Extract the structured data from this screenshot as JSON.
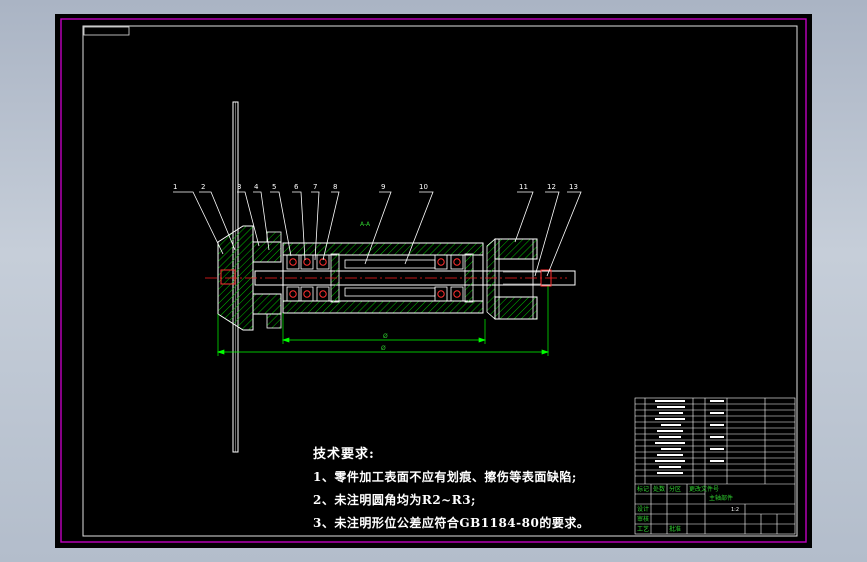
{
  "drawing": {
    "part_labels": [
      "1",
      "2",
      "3",
      "4",
      "5",
      "6",
      "7",
      "8",
      "9",
      "10",
      "11",
      "12",
      "13"
    ],
    "section_mark": "A-A",
    "dimension_text": "Ø"
  },
  "notes": {
    "title": "技术要求:",
    "lines": [
      "1、零件加工表面不应有划痕、擦伤等表面缺陷;",
      "2、未注明圆角均为R2~R3;",
      "3、未注明形位公差应符合GB1184-80的要求。"
    ]
  },
  "title_block": {
    "drawing_name": "主轴部件",
    "scale": "1:2",
    "green_cells": [
      "标记",
      "处数",
      "分区",
      "更改文件号",
      "签名",
      "年月日",
      "设计",
      "审核",
      "工艺",
      "批准"
    ]
  },
  "colors": {
    "frame": "#c000c0",
    "ink": "#ffffff",
    "dim": "#00ff00",
    "center": "#ff2020",
    "hatch": "#00c000",
    "bearing": "#ff3030"
  }
}
